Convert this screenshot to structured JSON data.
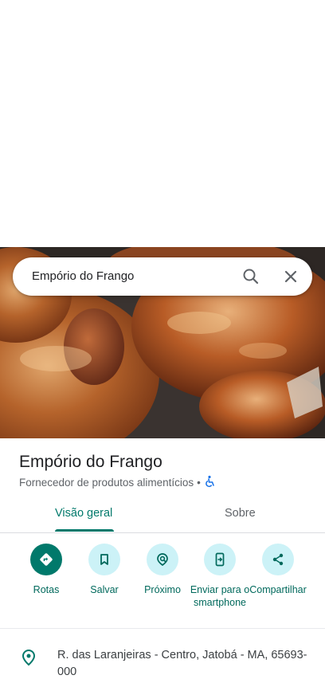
{
  "search": {
    "query": "Empório do Frango"
  },
  "place": {
    "name": "Empório do Frango",
    "category": "Fornecedor de produtos alimentícios",
    "separator": "•"
  },
  "tabs": [
    {
      "label": "Visão geral",
      "active": true
    },
    {
      "label": "Sobre",
      "active": false
    }
  ],
  "actions": [
    {
      "label": "Rotas",
      "icon": "directions-icon"
    },
    {
      "label": "Salvar",
      "icon": "bookmark-icon"
    },
    {
      "label": "Próximo",
      "icon": "nearby-icon"
    },
    {
      "label": "Enviar para o smartphone",
      "icon": "send-to-phone-icon"
    },
    {
      "label": "Compartilhar",
      "icon": "share-icon"
    }
  ],
  "address": "R. das Laranjeiras - Centro, Jatobá - MA, 65693-000",
  "colors": {
    "accent": "#00796b",
    "action_bg": "#ccf2f7",
    "accessible": "#1a73e8"
  }
}
